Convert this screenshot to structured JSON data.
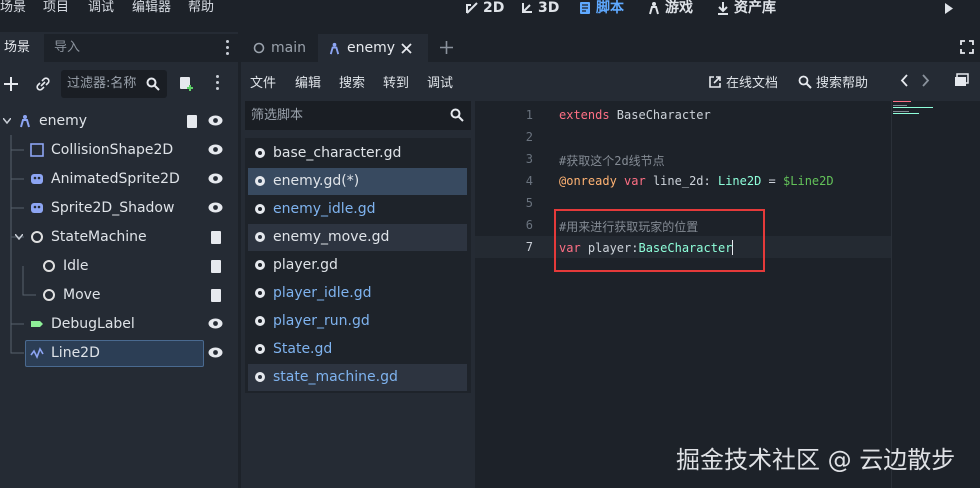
{
  "top_menu": [
    "场景",
    "项目",
    "调试",
    "编辑器",
    "帮助"
  ],
  "workspaces": [
    {
      "label": "2D",
      "icon": "2d-mode-icon",
      "active": false
    },
    {
      "label": "3D",
      "icon": "3d-mode-icon",
      "active": false
    },
    {
      "label": "脚本",
      "icon": "script-mode-icon",
      "active": true
    },
    {
      "label": "游戏",
      "icon": "game-mode-icon",
      "active": false
    },
    {
      "label": "资产库",
      "icon": "asset-lib-icon",
      "active": false
    }
  ],
  "dock": {
    "tabs": [
      "场景",
      "导入"
    ],
    "filter_placeholder": "过滤器:名称"
  },
  "scene_tree": [
    {
      "label": "enemy",
      "icon": "node2d-character-icon",
      "color": "#8da5f3"
    },
    {
      "label": "CollisionShape2D",
      "icon": "collision-shape-icon",
      "color": "#8da5f3"
    },
    {
      "label": "AnimatedSprite2D",
      "icon": "animated-sprite-icon",
      "color": "#8da5f3"
    },
    {
      "label": "Sprite2D_Shadow",
      "icon": "sprite-icon",
      "color": "#8da5f3"
    },
    {
      "label": "StateMachine",
      "icon": "node-icon",
      "color": "#e0e0e0"
    },
    {
      "label": "Idle",
      "icon": "node-icon",
      "color": "#e0e0e0"
    },
    {
      "label": "Move",
      "icon": "node-icon",
      "color": "#e0e0e0"
    },
    {
      "label": "DebugLabel",
      "icon": "label-icon",
      "color": "#8eef97"
    },
    {
      "label": "Line2D",
      "icon": "line2d-icon",
      "color": "#8da5f3"
    }
  ],
  "editor_tabs": [
    {
      "label": "main",
      "active": false
    },
    {
      "label": "enemy",
      "active": true
    }
  ],
  "script_menu": [
    "文件",
    "编辑",
    "搜索",
    "转到",
    "调试"
  ],
  "help_links": [
    "在线文档",
    "搜索帮助"
  ],
  "script_filter_placeholder": "筛选脚本",
  "scripts": [
    "base_character.gd",
    "enemy.gd(*)",
    "enemy_idle.gd",
    "enemy_move.gd",
    "player.gd",
    "player_idle.gd",
    "player_run.gd",
    "State.gd",
    "state_machine.gd"
  ],
  "code": {
    "line_numbers": [
      "1",
      "2",
      "3",
      "4",
      "5",
      "6",
      "7"
    ],
    "line1": {
      "kw": "extends",
      "rest": " BaseCharacter"
    },
    "line3": "#获取这个2d线节点",
    "line4": {
      "an": "@onready",
      "kw": "var",
      "name": " line_2d: ",
      "type": "Line2D",
      "eq": " = ",
      "np": "$Line2D"
    },
    "line6": "#用来进行获取玩家的位置",
    "line7": {
      "kw": "var",
      "rest": " player:",
      "type": "BaseCharacter"
    }
  },
  "watermark": "掘金技术社区 @ 云边散步",
  "colors": {
    "accent": "#5fa9ff",
    "annotation": "#e53a3a"
  }
}
